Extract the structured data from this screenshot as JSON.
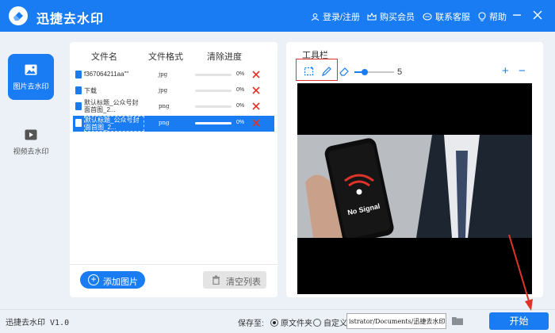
{
  "app": {
    "title": "迅捷去水印"
  },
  "header": {
    "login": "登录/注册",
    "vip": "购买会员",
    "support": "联系客服",
    "help": "帮助"
  },
  "sidebar": {
    "items": [
      {
        "label": "图片去水印",
        "active": true,
        "icon": "image-icon"
      },
      {
        "label": "视频去水印",
        "active": false,
        "icon": "video-play-icon"
      }
    ]
  },
  "file_list": {
    "columns": [
      "文件名",
      "文件格式",
      "清除进度"
    ],
    "rows": [
      {
        "name": "f367064211aa\"\"",
        "format": "jpg",
        "progress": "0%",
        "progress_value": 0,
        "selected": false
      },
      {
        "name": "下载",
        "format": "jpg",
        "progress": "0%",
        "progress_value": 0,
        "selected": false
      },
      {
        "name": "默认标题_公众号封面首图_2...",
        "format": "png",
        "progress": "0%",
        "progress_value": 0,
        "selected": false
      },
      {
        "name": "默认标题_公众号封面首图_2...",
        "format": "png",
        "progress": "0%",
        "progress_value": 0,
        "selected": true
      }
    ],
    "add_button": "添加图片",
    "clear_button": "清空列表"
  },
  "toolbar": {
    "title": "工具栏",
    "brush_size": "5",
    "brush_value": 5,
    "zoom_in": "+",
    "zoom_out": "−",
    "icons": [
      "select-rect-icon",
      "brush-icon",
      "eraser-icon"
    ]
  },
  "preview": {
    "sign_text": "No Signal"
  },
  "status": {
    "version": "迅捷去水印 V1.0",
    "save_to": "保存至:",
    "option_original": "原文件夹",
    "option_custom": "自定义",
    "path": "istrator/Documents/迅捷去水印",
    "start": "开始"
  },
  "colors": {
    "accent": "#1a7cf2",
    "danger": "#e0342a"
  }
}
